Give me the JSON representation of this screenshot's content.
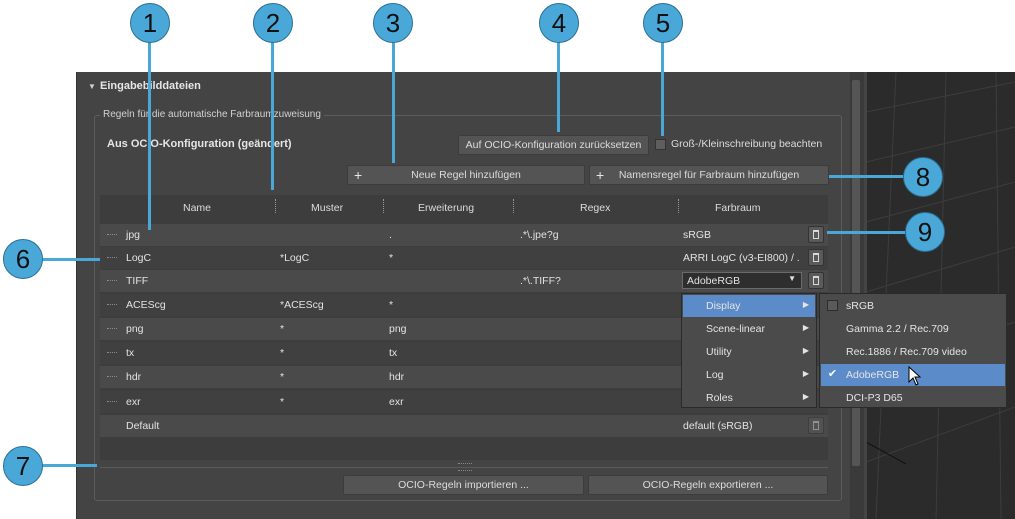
{
  "rollout": {
    "title": "Eingabebilddateien"
  },
  "group": {
    "legend": "Regeln für die automatische Farbraumzuweisung",
    "source_label": "Aus OCIO-Konfiguration (geändert)",
    "reset_label": "Auf OCIO-Konfiguration zurücksetzen",
    "case_label": "Groß-/Kleinschreibung beachten",
    "case_checked": false,
    "new_rule_label": "Neue Regel hinzufügen",
    "colorspace_rule_label": "Namensregel für Farbraum hinzufügen",
    "import_label": "OCIO-Regeln importieren ...",
    "export_label": "OCIO-Regeln exportieren ..."
  },
  "table": {
    "columns": [
      "Name",
      "Muster",
      "Erweiterung",
      "Regex",
      "Farbraum"
    ],
    "rows": [
      {
        "name": "jpg",
        "pattern": "",
        "extension": ".",
        "regex": ".*\\.jpe?g",
        "colorspace": "sRGB"
      },
      {
        "name": "LogC",
        "pattern": "*LogC",
        "extension": "*",
        "regex": "",
        "colorspace": "ARRI LogC (v3-EI800) / ."
      },
      {
        "name": "TIFF",
        "pattern": "",
        "extension": "",
        "regex": ".*\\.TIFF?",
        "colorspace": "AdobeRGB"
      },
      {
        "name": "ACEScg",
        "pattern": "*ACEScg",
        "extension": "*",
        "regex": "",
        "colorspace": ""
      },
      {
        "name": "png",
        "pattern": "*",
        "extension": "png",
        "regex": "",
        "colorspace": ""
      },
      {
        "name": "tx",
        "pattern": "*",
        "extension": "tx",
        "regex": "",
        "colorspace": ""
      },
      {
        "name": "hdr",
        "pattern": "*",
        "extension": "hdr",
        "regex": "",
        "colorspace": ""
      },
      {
        "name": "exr",
        "pattern": "*",
        "extension": "exr",
        "regex": "",
        "colorspace": ""
      },
      {
        "name": "Default",
        "pattern": "",
        "extension": "",
        "regex": "",
        "colorspace": "default (sRGB)"
      }
    ]
  },
  "menu_categories": [
    "Display",
    "Scene-linear",
    "Utility",
    "Log",
    "Roles"
  ],
  "menu_display_items": [
    {
      "label": "sRGB",
      "checked": false
    },
    {
      "label": "Gamma 2.2 / Rec.709",
      "checked": false
    },
    {
      "label": "Rec.1886 / Rec.709 video",
      "checked": false
    },
    {
      "label": "AdobeRGB",
      "checked": true
    },
    {
      "label": "DCI-P3 D65",
      "checked": false
    }
  ],
  "callouts": [
    "1",
    "2",
    "3",
    "4",
    "5",
    "6",
    "7",
    "8",
    "9"
  ],
  "colors": {
    "accent": "#4aa8d8",
    "highlight": "#5c8bc9",
    "panel": "#444444"
  }
}
